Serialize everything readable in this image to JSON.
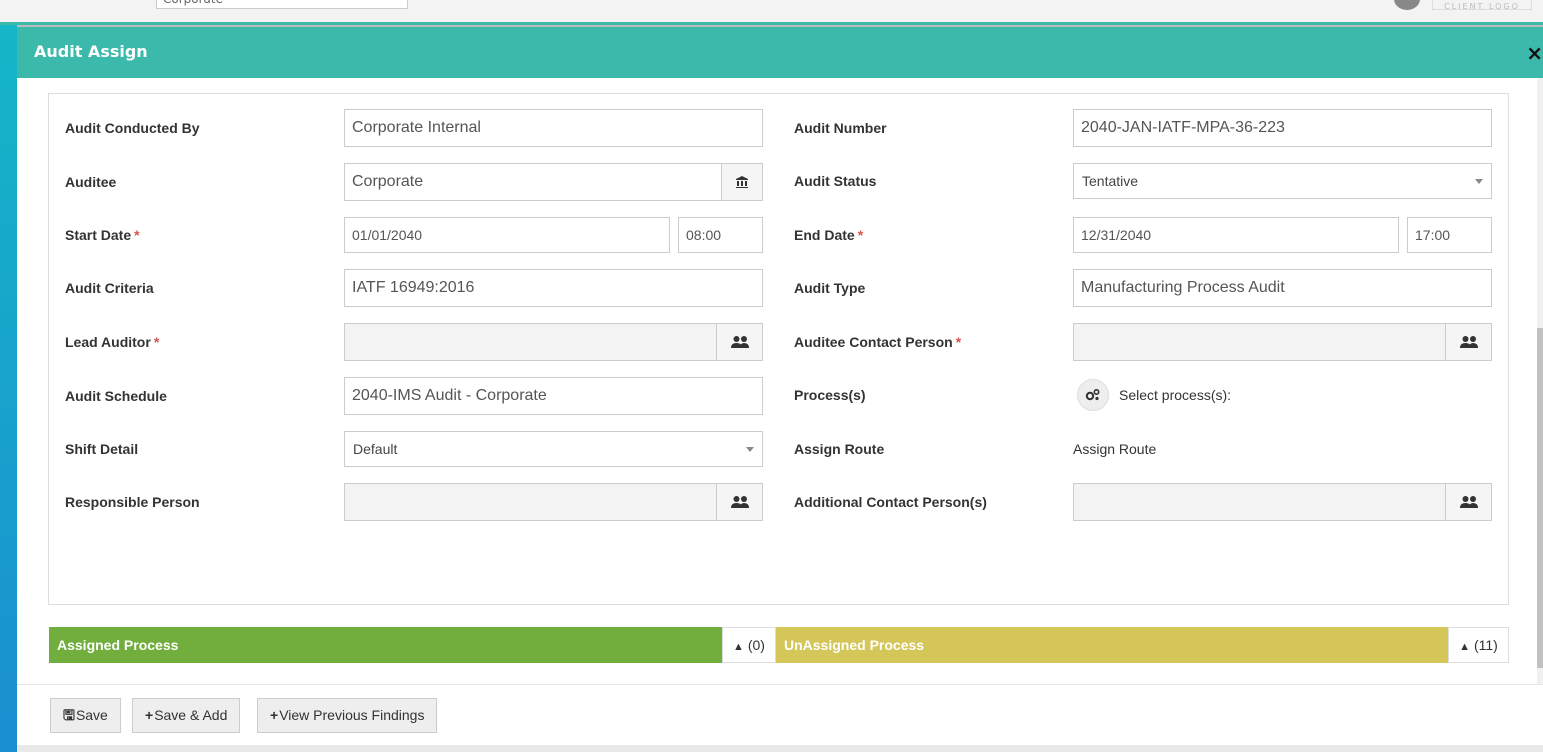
{
  "topbar": {
    "company_value": "Corporate",
    "client_logo_text": "CLIENT LOGO"
  },
  "modal": {
    "title": "Audit Assign",
    "close_symbol": "×"
  },
  "form": {
    "audit_conducted_by": {
      "label": "Audit Conducted By",
      "value": "Corporate Internal"
    },
    "audit_number": {
      "label": "Audit Number",
      "value": "2040-JAN-IATF-MPA-36-223"
    },
    "auditee": {
      "label": "Auditee",
      "value": "Corporate"
    },
    "audit_status": {
      "label": "Audit Status",
      "value": "Tentative"
    },
    "start_date": {
      "label": "Start Date",
      "date": "01/01/2040",
      "time": "08:00",
      "required": "*"
    },
    "end_date": {
      "label": "End Date",
      "date": "12/31/2040",
      "time": "17:00",
      "required": "*"
    },
    "audit_criteria": {
      "label": "Audit Criteria",
      "value": "IATF 16949:2016"
    },
    "audit_type": {
      "label": "Audit Type",
      "value": "Manufacturing Process Audit"
    },
    "lead_auditor": {
      "label": "Lead Auditor",
      "value": "",
      "required": "*"
    },
    "auditee_contact_person": {
      "label": "Auditee Contact Person",
      "value": "",
      "required": "*"
    },
    "audit_schedule": {
      "label": "Audit Schedule",
      "value": "2040-IMS Audit - Corporate"
    },
    "processes": {
      "label": "Process(s)",
      "select_text": "Select process(s):"
    },
    "shift_detail": {
      "label": "Shift Detail",
      "value": "Default"
    },
    "assign_route": {
      "label": "Assign Route",
      "value": "Assign Route"
    },
    "responsible_person": {
      "label": "Responsible Person",
      "value": ""
    },
    "additional_contact_persons": {
      "label": "Additional Contact Person(s)",
      "value": ""
    }
  },
  "process_bars": {
    "assigned": {
      "label": "Assigned Process",
      "count": "(0)",
      "color": "#72ae3d"
    },
    "unassigned": {
      "label": "UnAssigned Process",
      "count": "(11)",
      "color": "#d4c659"
    }
  },
  "footer": {
    "save_label": "Save",
    "save_add_label": "Save & Add",
    "view_findings_label": "View Previous Findings"
  },
  "colors": {
    "header": "#3bb9aa",
    "required": "#d9534f"
  }
}
